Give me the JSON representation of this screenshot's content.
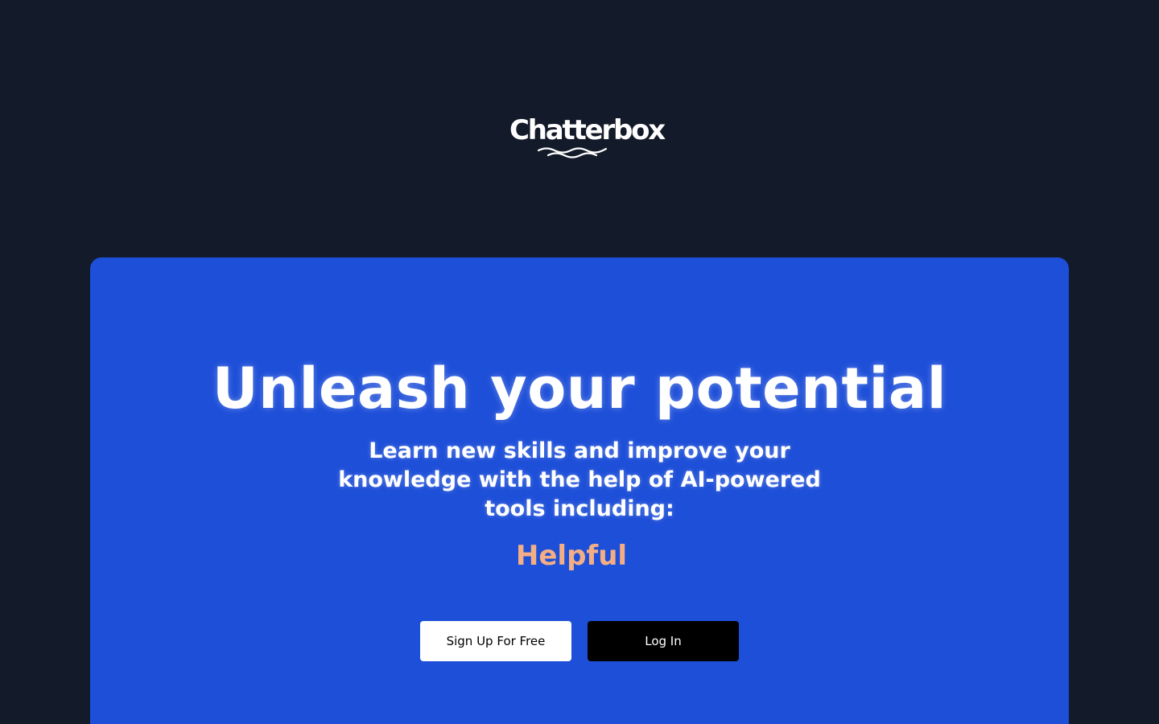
{
  "brand": {
    "name": "Chatterbox",
    "logo_icon": "waves-icon"
  },
  "hero": {
    "headline": "Unleash your potential",
    "subheadline": "Learn new skills and improve your knowledge with the help of AI-powered tools including:",
    "rotating_word": "Helpful"
  },
  "actions": {
    "signup_label": "Sign Up For Free",
    "login_label": "Log In"
  },
  "colors": {
    "page_background": "#131a29",
    "hero_background": "#1e4fd8",
    "accent_word": "#f4ae85",
    "signup_background": "#ffffff",
    "login_background": "#000000"
  }
}
